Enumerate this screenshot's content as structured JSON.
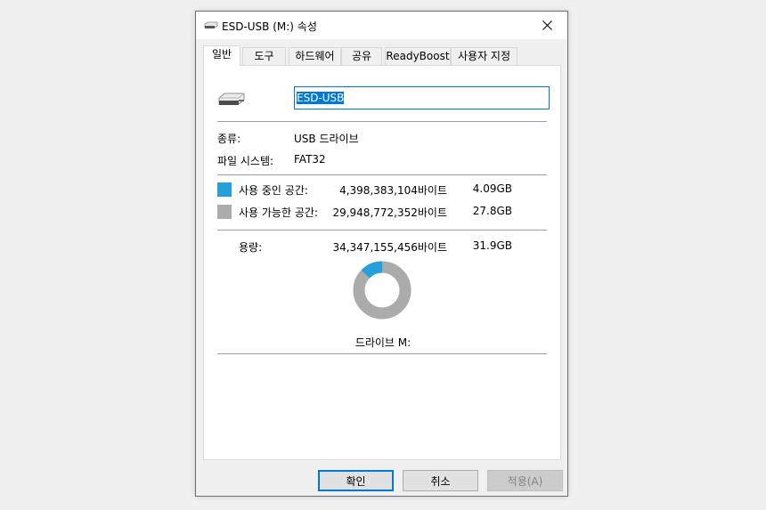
{
  "window": {
    "title": "ESD-USB (M:) 속성"
  },
  "tabs": [
    {
      "label": "일반"
    },
    {
      "label": "도구"
    },
    {
      "label": "하드웨어"
    },
    {
      "label": "공유"
    },
    {
      "label": "ReadyBoost"
    },
    {
      "label": "사용자 지정"
    }
  ],
  "general": {
    "volume_name": "ESD-USB",
    "type_label": "종류:",
    "type_value": "USB 드라이브",
    "fs_label": "파일 시스템:",
    "fs_value": "FAT32",
    "used_label": "사용 중인 공간:",
    "used_bytes": "4,398,383,104바이트",
    "used_size": "4.09GB",
    "free_label": "사용 가능한 공간:",
    "free_bytes": "29,948,772,352바이트",
    "free_size": "27.8GB",
    "capacity_label": "용량:",
    "capacity_bytes": "34,347,155,456바이트",
    "capacity_size": "31.9GB",
    "drive_label": "드라이브 M:",
    "used_color": "#26a0da",
    "free_color": "#ababab",
    "used_fraction": 0.128
  },
  "buttons": {
    "ok": "확인",
    "cancel": "취소",
    "apply": "적용(A)"
  }
}
